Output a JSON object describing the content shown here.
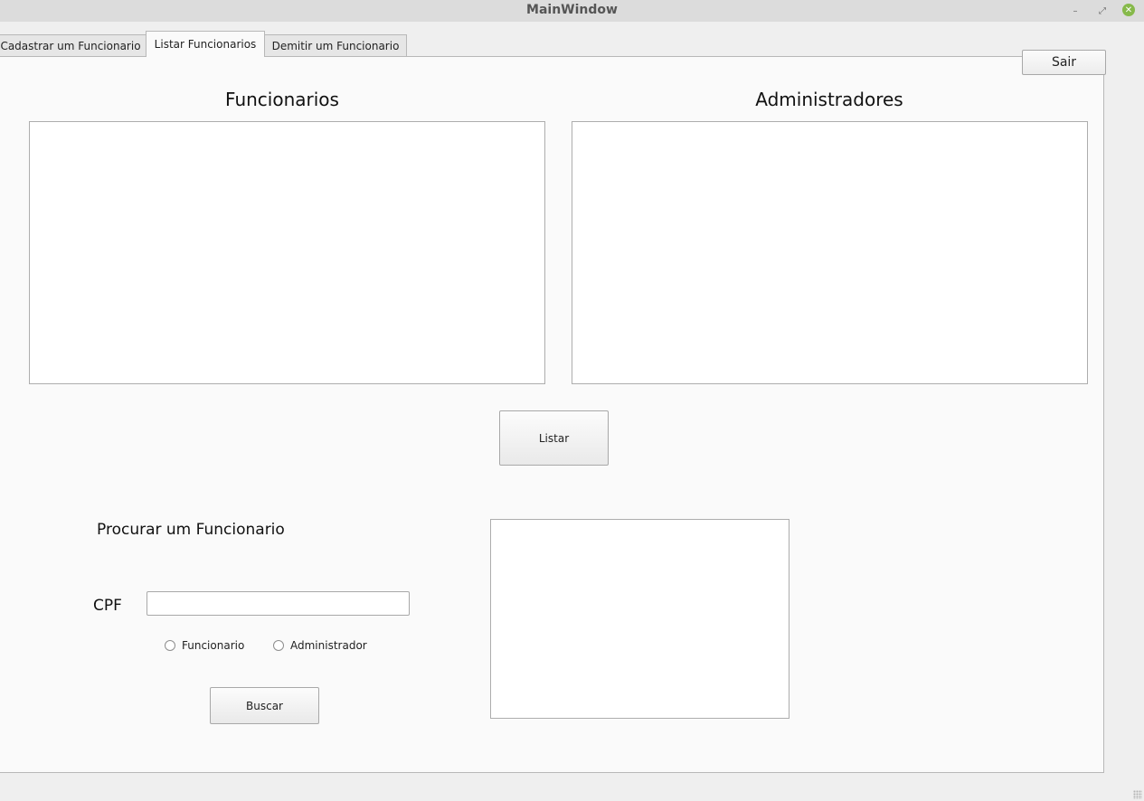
{
  "window": {
    "title": "MainWindow",
    "controls": {
      "minimize_glyph": "–",
      "maximize_glyph": "⤢",
      "close_glyph": "✕"
    }
  },
  "tabs": [
    {
      "label": "Cadastrar um Funcionario",
      "active": false
    },
    {
      "label": "Listar Funcionarios",
      "active": true
    },
    {
      "label": "Demitir um Funcionario",
      "active": false
    }
  ],
  "header": {
    "exit_label": "Sair"
  },
  "lists": {
    "funcionarios_title": "Funcionarios",
    "administradores_title": "Administradores",
    "funcionarios_items": [],
    "administradores_items": []
  },
  "listar_button": "Listar",
  "search": {
    "title": "Procurar um Funcionario",
    "cpf_label": "CPF",
    "cpf_value": "",
    "radio_funcionario": "Funcionario",
    "radio_administrador": "Administrador",
    "selected_type": "",
    "buscar_label": "Buscar",
    "results": []
  },
  "colors": {
    "titlebar": "#dcdcdc",
    "panel": "#fafafa",
    "close_button": "#86b94a"
  }
}
